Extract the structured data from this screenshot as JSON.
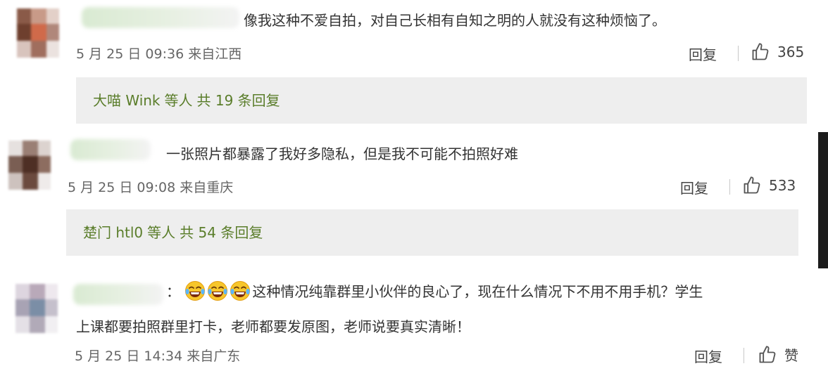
{
  "comments": [
    {
      "text": "像我这种不爱自拍，对自己长相有自知之明的人就没有这种烦恼了。",
      "meta": "5 月 25 日 09:36 来自江西",
      "reply_label": "回复",
      "likes": "365",
      "thread": {
        "names": "大喵 Wink",
        "suffix": "等人",
        "count_text": "共 19 条回复"
      }
    },
    {
      "text": "一张照片都暴露了我好多隐私，但是我不可能不拍照好难",
      "meta": "5 月 25 日 09:08 来自重庆",
      "reply_label": "回复",
      "likes": "533",
      "thread": {
        "names": "楚门 htl0",
        "suffix": "等人",
        "count_text": "共 54 条回复"
      }
    },
    {
      "colon": "：",
      "emoji": [
        "laughing-crying-emoji",
        "laughing-crying-emoji",
        "laughing-crying-emoji"
      ],
      "text_line1": "这种情况纯靠群里小伙伴的良心了，现在什么情况下不用不用手机？学生",
      "text_line2": "上课都要拍照群里打卡，老师都要发原图，老师说要真实清晰！",
      "meta": "5 月 25 日 14:34 来自广东",
      "reply_label": "回复",
      "likes": "赞"
    }
  ],
  "colors": {
    "link_green": "#5a7d2a",
    "thread_bg": "#eeeeee",
    "meta_gray": "#666666"
  }
}
